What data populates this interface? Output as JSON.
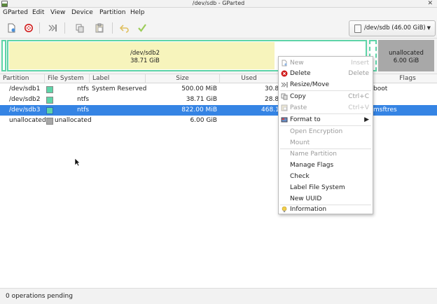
{
  "window": {
    "title": "/dev/sdb - GParted"
  },
  "menubar": [
    "GParted",
    "Edit",
    "View",
    "Device",
    "Partition",
    "Help"
  ],
  "toolbar": {
    "icons": [
      "new-icon",
      "delete-icon",
      "resize-move-icon",
      "copy-icon",
      "paste-icon",
      "undo-icon",
      "apply-icon"
    ],
    "device": "/dev/sdb (46.00 GiB)"
  },
  "colors": {
    "ntfs": "#5ed4a8",
    "unallocated": "#a8a8a8",
    "used": "#f7f4bc",
    "selection": "#3584e4",
    "frame": "#5ed4a8"
  },
  "diskmap": {
    "sdb2": {
      "name": "/dev/sdb2",
      "size": "38.71 GiB"
    },
    "unallocated": {
      "name": "unallocated",
      "size": "6.00 GiB"
    }
  },
  "columns": [
    "Partition",
    "File System",
    "Label",
    "Size",
    "Used",
    "Flags"
  ],
  "rows": [
    {
      "partition": "/dev/sdb1",
      "fs": "ntfs",
      "label": "System Reserved",
      "size": "500.00 MiB",
      "used": "30.8",
      "flags": "boot"
    },
    {
      "partition": "/dev/sdb2",
      "fs": "ntfs",
      "label": "",
      "size": "38.71 GiB",
      "used": "28.8",
      "flags": ""
    },
    {
      "partition": "/dev/sdb3",
      "fs": "ntfs",
      "label": "",
      "size": "822.00 MiB",
      "used": "468.1",
      "flags": "msftres"
    },
    {
      "partition": "unallocated",
      "fs": "unallocated",
      "label": "",
      "size": "6.00 GiB",
      "used": "",
      "flags": ""
    }
  ],
  "context_menu": {
    "items": [
      {
        "label": "New",
        "accel": "Insert"
      },
      {
        "label": "Delete",
        "accel": "Delete"
      },
      {
        "label": "Resize/Move",
        "accel": ""
      },
      {
        "label": "Copy",
        "accel": "Ctrl+C"
      },
      {
        "label": "Paste",
        "accel": "Ctrl+V"
      },
      {
        "label": "Format to",
        "accel": ""
      },
      {
        "label": "Open Encryption",
        "accel": ""
      },
      {
        "label": "Mount",
        "accel": ""
      },
      {
        "label": "Name Partition",
        "accel": ""
      },
      {
        "label": "Manage Flags",
        "accel": ""
      },
      {
        "label": "Check",
        "accel": ""
      },
      {
        "label": "Label File System",
        "accel": ""
      },
      {
        "label": "New UUID",
        "accel": ""
      },
      {
        "label": "Information",
        "accel": ""
      }
    ]
  },
  "status": {
    "text": "0 operations pending"
  }
}
